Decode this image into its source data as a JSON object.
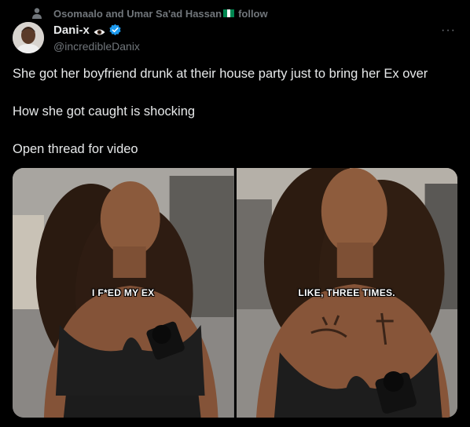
{
  "social_context": {
    "text": "Osomaalo and Umar Sa'ad Hassan",
    "follow_label": "follow",
    "icon": "person-icon",
    "flag_colors": [
      "#008751",
      "#ffffff",
      "#008751"
    ]
  },
  "author": {
    "display_name": "Dani-x",
    "handle": "@incredibleDanix",
    "emoji": "eye-icon",
    "verified_color": "#1d9bf0"
  },
  "more_label": "···",
  "tweet": {
    "lines": [
      "She got her boyfriend drunk at their house party just to bring her Ex over",
      "How she got caught is shocking",
      "Open thread for video"
    ]
  },
  "media": {
    "left_caption": "I F*ED MY EX",
    "right_caption": "LIKE, THREE TIMES."
  },
  "colors": {
    "background": "#000000",
    "text": "#e7e9ea",
    "muted": "#71767b"
  }
}
